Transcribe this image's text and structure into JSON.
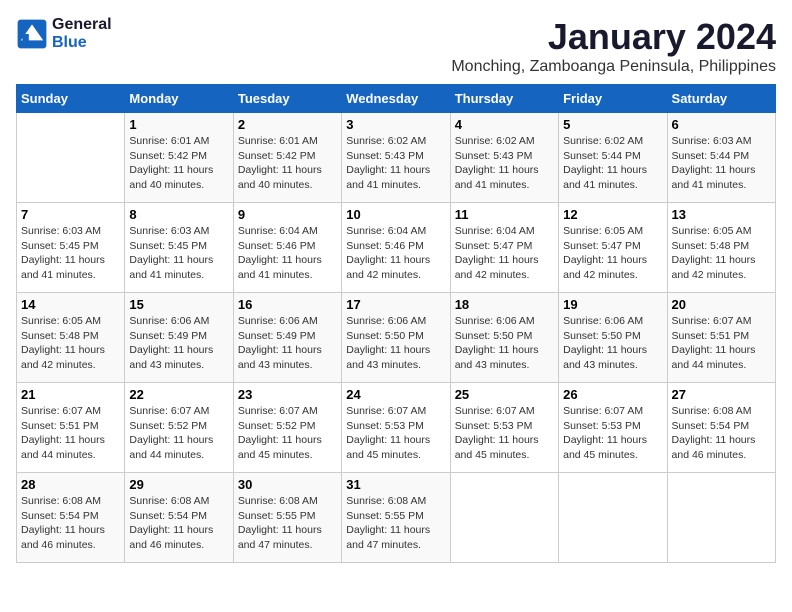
{
  "header": {
    "logo_line1": "General",
    "logo_line2": "Blue",
    "month": "January 2024",
    "location": "Monching, Zamboanga Peninsula, Philippines"
  },
  "weekdays": [
    "Sunday",
    "Monday",
    "Tuesday",
    "Wednesday",
    "Thursday",
    "Friday",
    "Saturday"
  ],
  "weeks": [
    [
      {
        "day": "",
        "info": ""
      },
      {
        "day": "1",
        "info": "Sunrise: 6:01 AM\nSunset: 5:42 PM\nDaylight: 11 hours\nand 40 minutes."
      },
      {
        "day": "2",
        "info": "Sunrise: 6:01 AM\nSunset: 5:42 PM\nDaylight: 11 hours\nand 40 minutes."
      },
      {
        "day": "3",
        "info": "Sunrise: 6:02 AM\nSunset: 5:43 PM\nDaylight: 11 hours\nand 41 minutes."
      },
      {
        "day": "4",
        "info": "Sunrise: 6:02 AM\nSunset: 5:43 PM\nDaylight: 11 hours\nand 41 minutes."
      },
      {
        "day": "5",
        "info": "Sunrise: 6:02 AM\nSunset: 5:44 PM\nDaylight: 11 hours\nand 41 minutes."
      },
      {
        "day": "6",
        "info": "Sunrise: 6:03 AM\nSunset: 5:44 PM\nDaylight: 11 hours\nand 41 minutes."
      }
    ],
    [
      {
        "day": "7",
        "info": "Sunrise: 6:03 AM\nSunset: 5:45 PM\nDaylight: 11 hours\nand 41 minutes."
      },
      {
        "day": "8",
        "info": "Sunrise: 6:03 AM\nSunset: 5:45 PM\nDaylight: 11 hours\nand 41 minutes."
      },
      {
        "day": "9",
        "info": "Sunrise: 6:04 AM\nSunset: 5:46 PM\nDaylight: 11 hours\nand 41 minutes."
      },
      {
        "day": "10",
        "info": "Sunrise: 6:04 AM\nSunset: 5:46 PM\nDaylight: 11 hours\nand 42 minutes."
      },
      {
        "day": "11",
        "info": "Sunrise: 6:04 AM\nSunset: 5:47 PM\nDaylight: 11 hours\nand 42 minutes."
      },
      {
        "day": "12",
        "info": "Sunrise: 6:05 AM\nSunset: 5:47 PM\nDaylight: 11 hours\nand 42 minutes."
      },
      {
        "day": "13",
        "info": "Sunrise: 6:05 AM\nSunset: 5:48 PM\nDaylight: 11 hours\nand 42 minutes."
      }
    ],
    [
      {
        "day": "14",
        "info": "Sunrise: 6:05 AM\nSunset: 5:48 PM\nDaylight: 11 hours\nand 42 minutes."
      },
      {
        "day": "15",
        "info": "Sunrise: 6:06 AM\nSunset: 5:49 PM\nDaylight: 11 hours\nand 43 minutes."
      },
      {
        "day": "16",
        "info": "Sunrise: 6:06 AM\nSunset: 5:49 PM\nDaylight: 11 hours\nand 43 minutes."
      },
      {
        "day": "17",
        "info": "Sunrise: 6:06 AM\nSunset: 5:50 PM\nDaylight: 11 hours\nand 43 minutes."
      },
      {
        "day": "18",
        "info": "Sunrise: 6:06 AM\nSunset: 5:50 PM\nDaylight: 11 hours\nand 43 minutes."
      },
      {
        "day": "19",
        "info": "Sunrise: 6:06 AM\nSunset: 5:50 PM\nDaylight: 11 hours\nand 43 minutes."
      },
      {
        "day": "20",
        "info": "Sunrise: 6:07 AM\nSunset: 5:51 PM\nDaylight: 11 hours\nand 44 minutes."
      }
    ],
    [
      {
        "day": "21",
        "info": "Sunrise: 6:07 AM\nSunset: 5:51 PM\nDaylight: 11 hours\nand 44 minutes."
      },
      {
        "day": "22",
        "info": "Sunrise: 6:07 AM\nSunset: 5:52 PM\nDaylight: 11 hours\nand 44 minutes."
      },
      {
        "day": "23",
        "info": "Sunrise: 6:07 AM\nSunset: 5:52 PM\nDaylight: 11 hours\nand 45 minutes."
      },
      {
        "day": "24",
        "info": "Sunrise: 6:07 AM\nSunset: 5:53 PM\nDaylight: 11 hours\nand 45 minutes."
      },
      {
        "day": "25",
        "info": "Sunrise: 6:07 AM\nSunset: 5:53 PM\nDaylight: 11 hours\nand 45 minutes."
      },
      {
        "day": "26",
        "info": "Sunrise: 6:07 AM\nSunset: 5:53 PM\nDaylight: 11 hours\nand 45 minutes."
      },
      {
        "day": "27",
        "info": "Sunrise: 6:08 AM\nSunset: 5:54 PM\nDaylight: 11 hours\nand 46 minutes."
      }
    ],
    [
      {
        "day": "28",
        "info": "Sunrise: 6:08 AM\nSunset: 5:54 PM\nDaylight: 11 hours\nand 46 minutes."
      },
      {
        "day": "29",
        "info": "Sunrise: 6:08 AM\nSunset: 5:54 PM\nDaylight: 11 hours\nand 46 minutes."
      },
      {
        "day": "30",
        "info": "Sunrise: 6:08 AM\nSunset: 5:55 PM\nDaylight: 11 hours\nand 47 minutes."
      },
      {
        "day": "31",
        "info": "Sunrise: 6:08 AM\nSunset: 5:55 PM\nDaylight: 11 hours\nand 47 minutes."
      },
      {
        "day": "",
        "info": ""
      },
      {
        "day": "",
        "info": ""
      },
      {
        "day": "",
        "info": ""
      }
    ]
  ]
}
